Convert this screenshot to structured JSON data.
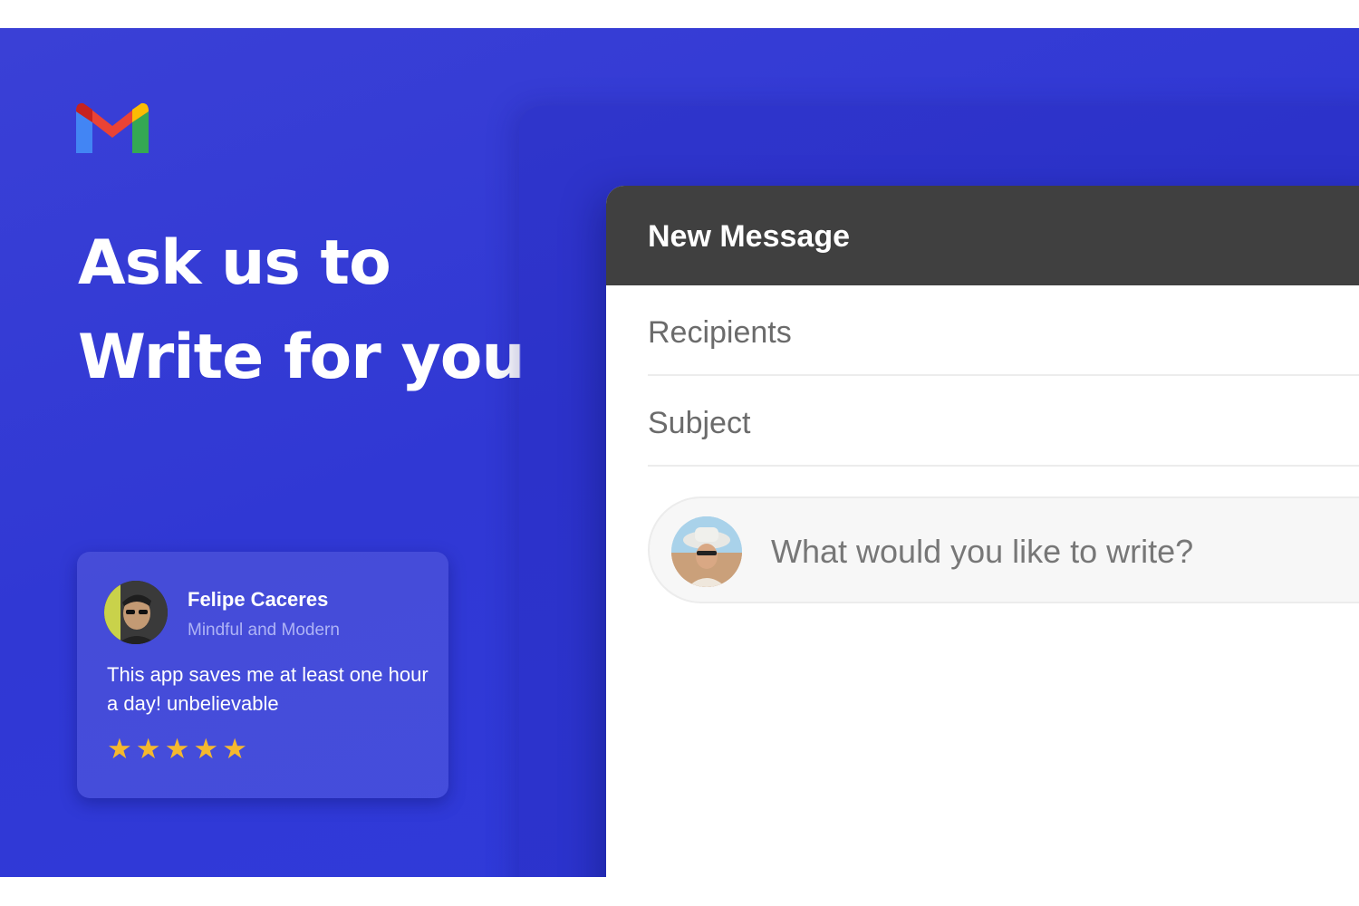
{
  "brand": {
    "logo_icon": "gmail-logo-icon"
  },
  "headline": {
    "line1": "Ask us to",
    "line2": "Write for you"
  },
  "review": {
    "name": "Felipe Caceres",
    "role": "Mindful and Modern",
    "text": "This app saves me at least one hour a day! unbelievable",
    "stars": [
      "★",
      "★",
      "★",
      "★",
      "★"
    ],
    "rating": 5,
    "star_color": "#f5b82e"
  },
  "compose": {
    "title": "New Message",
    "recipients_placeholder": "Recipients",
    "subject_placeholder": "Subject",
    "prompt_placeholder": "What would you like to write?"
  },
  "colors": {
    "background": "#3038d4",
    "header_bar": "#404040",
    "accent_red": "#ea4335",
    "accent_blue": "#4285f4",
    "accent_green": "#34a853",
    "accent_yellow": "#fbbc04"
  }
}
